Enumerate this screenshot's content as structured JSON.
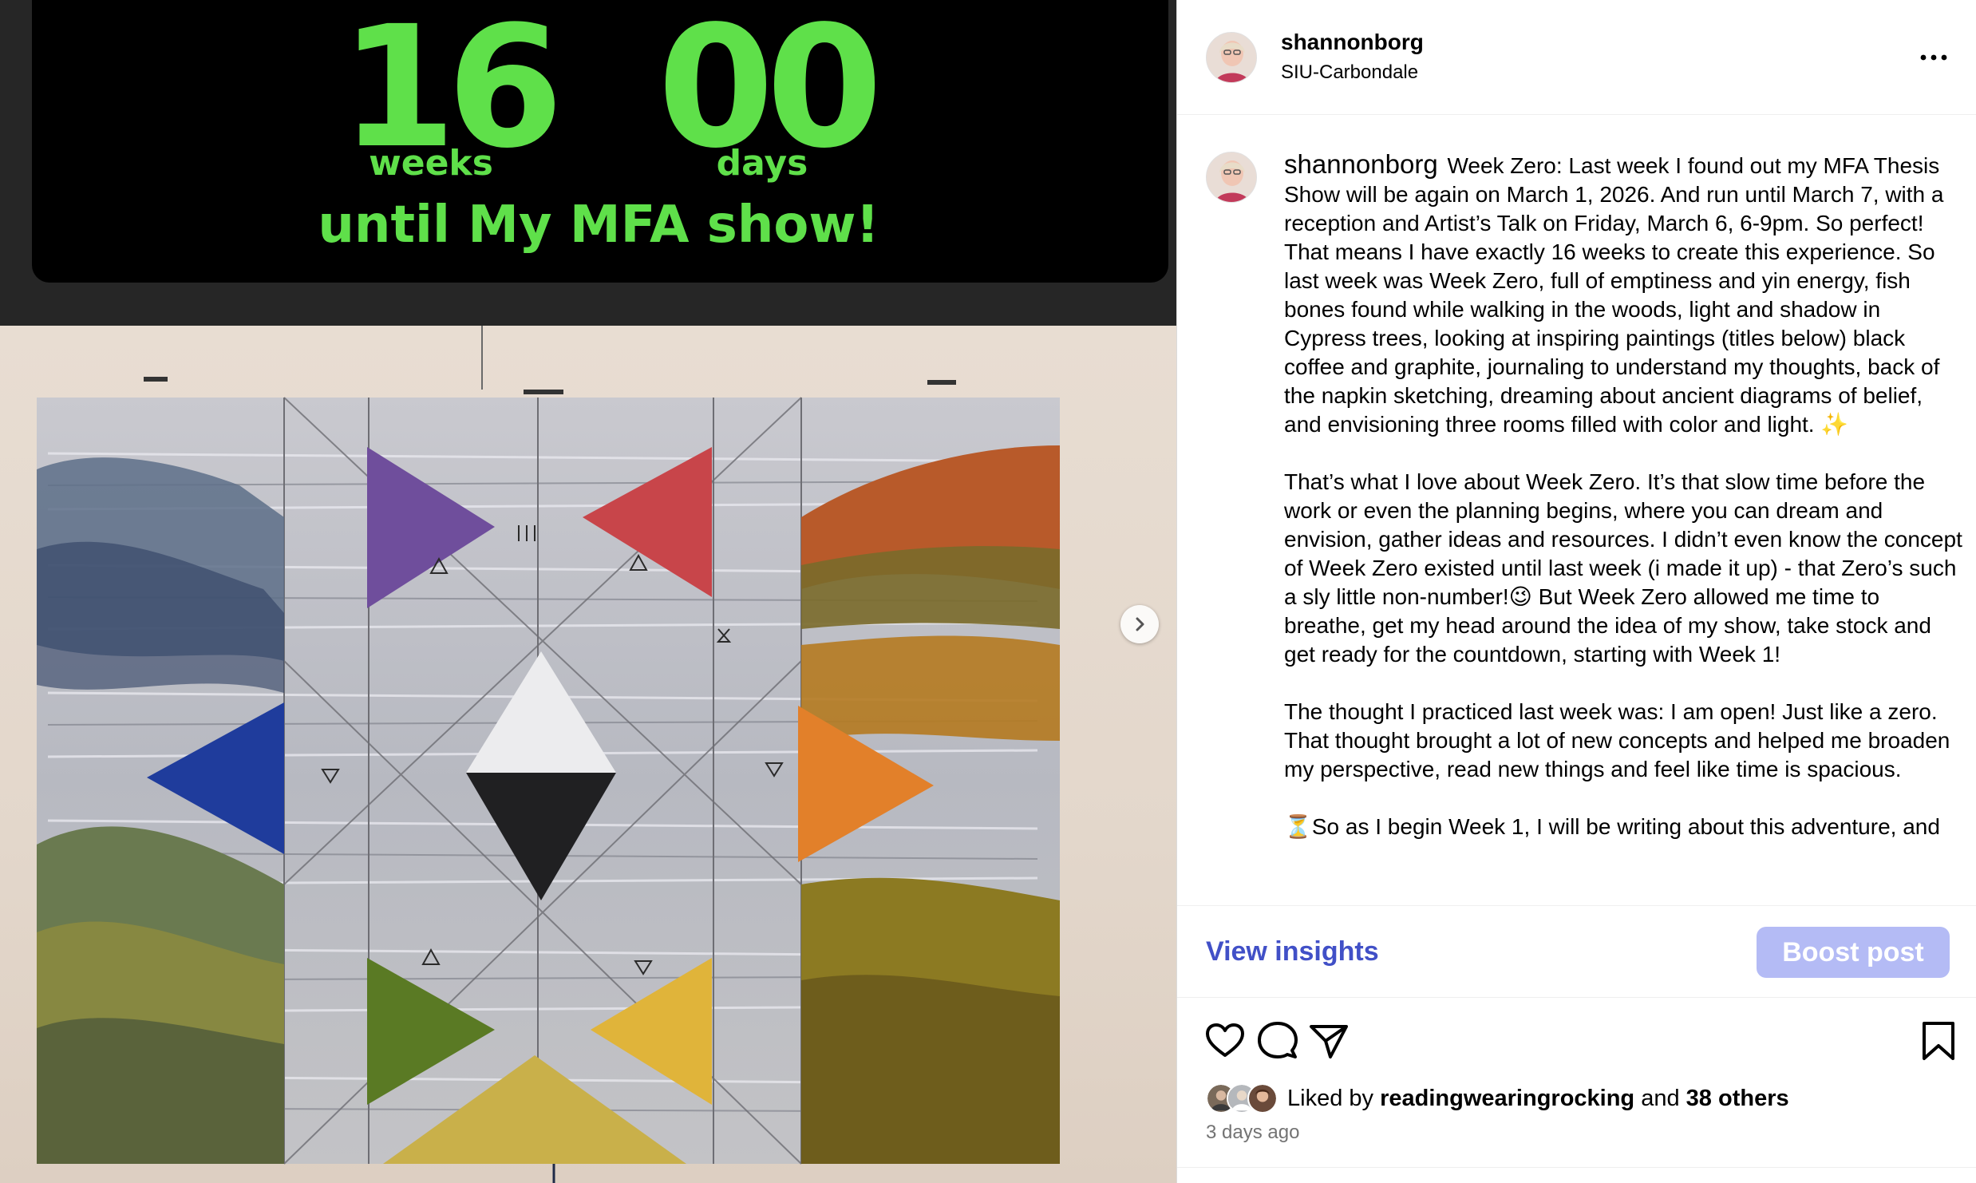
{
  "post_image": {
    "countdown": {
      "weeks_number": "16",
      "weeks_label": "weeks",
      "days_number": "00",
      "days_label": "days",
      "tagline": "until My MFA show!",
      "text_color": "#5fe04a"
    },
    "next_icon": "chevron-right-icon"
  },
  "header": {
    "username": "shannonborg",
    "location": "SIU-Carbondale",
    "more_icon": "more-horizontal-icon"
  },
  "caption": {
    "username": "shannonborg",
    "p1": "Week Zero: Last week I found out my MFA Thesis Show will be again on March 1, 2026. And run until March 7, with a reception and Artist’s Talk on Friday, March 6, 6-9pm. So perfect! That means I have exactly 16 weeks to create this experience. So last week was Week Zero, full of emptiness and yin energy, fish bones found while walking in the woods, light and shadow in Cypress trees, looking at inspiring paintings (titles below) black coffee and graphite, journaling to understand my thoughts, back of the napkin sketching, dreaming about ancient diagrams of belief, and envisioning three rooms filled with color and light. ✨",
    "p2": "That’s what I love about Week Zero. It’s that slow time before the work or even the planning begins, where you can dream and envision, gather ideas and resources. I didn’t even know the concept of Week Zero existed until last week (i made it up) - that Zero’s such a sly little non-number!😉 But Week Zero allowed me time to breathe, get my head around the idea of my show, take stock and get ready for the countdown, starting with Week 1!",
    "p3": "The thought I practiced last week was: I am open! Just like a zero. That thought brought a lot of new concepts and helped me broaden my perspective, read new things and feel like time is spacious.",
    "p4": "⏳So as I begin Week 1, I will be writing about this adventure, and"
  },
  "insights": {
    "view_label": "View insights",
    "boost_label": "Boost post",
    "link_color": "#4150c7",
    "boost_color": "#b4bbf5"
  },
  "actions": {
    "icons": [
      "heart-icon",
      "comment-icon",
      "share-icon",
      "bookmark-icon"
    ]
  },
  "likes": {
    "prefix": "Liked by",
    "first_user": "readingwearingrocking",
    "connector": "and",
    "others": "38 others"
  },
  "timestamp": "3 days ago"
}
